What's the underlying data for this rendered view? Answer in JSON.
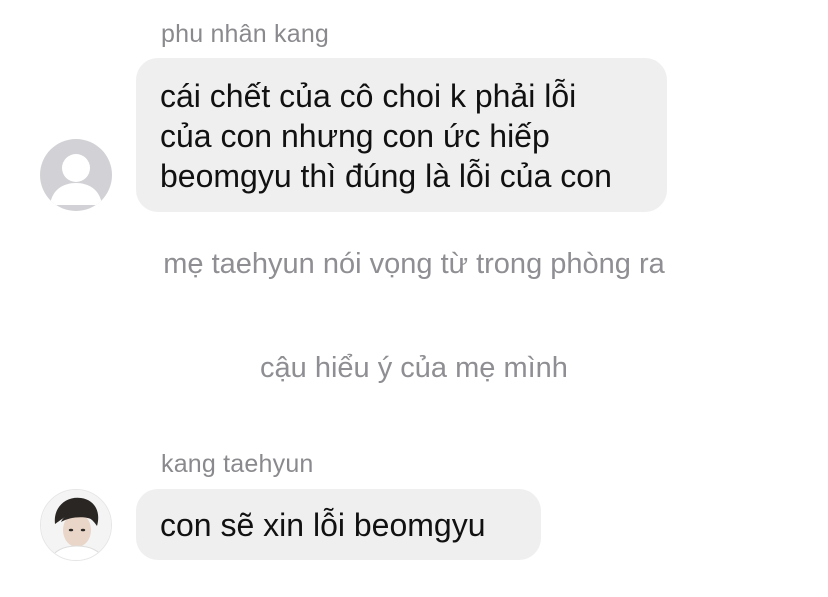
{
  "messages": [
    {
      "sender": "phu nhân kang",
      "lines": [
        "cái chết của cô choi k phải lỗi",
        "của con nhưng con ức hiếp",
        "beomgyu thì đúng là lỗi của con"
      ],
      "avatar_icon": "default-avatar-icon"
    },
    {
      "sender": "kang taehyun",
      "lines": [
        "con sẽ xin lỗi beomgyu"
      ],
      "avatar_icon": "profile-photo"
    }
  ],
  "narration": [
    "mẹ taehyun nói vọng từ trong phòng ra",
    "cậu hiểu ý của mẹ mình"
  ],
  "colors": {
    "bubble": "#efeff0",
    "sender_name": "#8a8a8e",
    "narration": "#8e8e93",
    "message_text": "#111111",
    "default_avatar_bg": "#d1d1d6"
  }
}
